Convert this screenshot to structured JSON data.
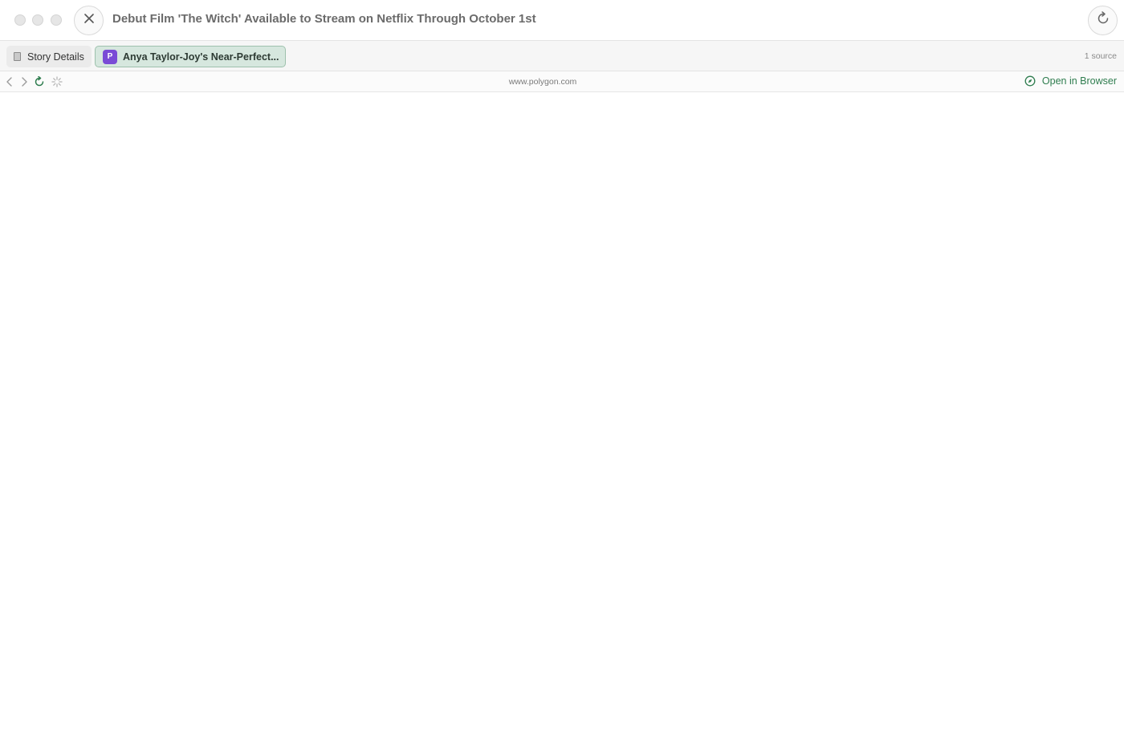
{
  "window": {
    "title": "Debut Film 'The Witch' Available to Stream on Netflix Through October 1st"
  },
  "tabs": [
    {
      "label": "Story Details",
      "icon": "document-icon"
    },
    {
      "label": "Anya Taylor-Joy's Near-Perfect...",
      "badge": "P",
      "badge_color": "#7a4bd6",
      "active": true
    }
  ],
  "source_count": "1 source",
  "nav": {
    "url": "www.polygon.com",
    "open_in_browser": "Open in Browser",
    "icons": [
      "chevron-left-icon",
      "chevron-right-icon",
      "reload-icon",
      "loading-spinner-icon"
    ]
  },
  "colors": {
    "accent_green": "#2f7d4f",
    "active_tab_bg": "#d6e7de",
    "title_text": "#6b6b6b"
  }
}
